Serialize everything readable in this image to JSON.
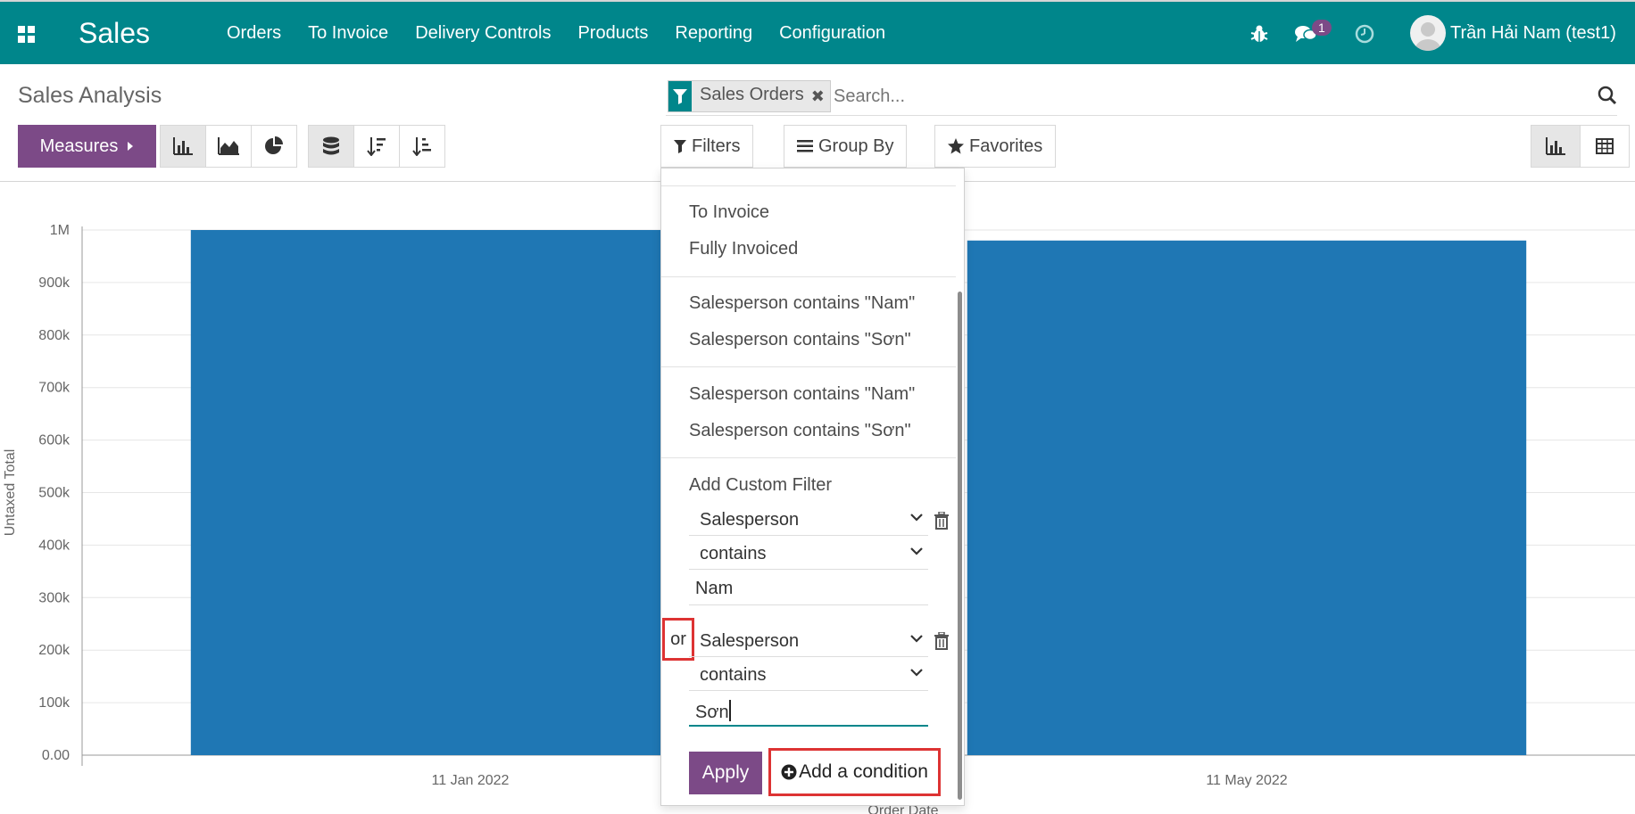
{
  "navbar": {
    "app_name": "Sales",
    "menu": [
      "Orders",
      "To Invoice",
      "Delivery Controls",
      "Products",
      "Reporting",
      "Configuration"
    ],
    "chat_count": "1",
    "user_name": "Trần Hải Nam (test1)"
  },
  "page": {
    "title": "Sales Analysis"
  },
  "search": {
    "facet_label": "Sales Orders",
    "placeholder": "Search..."
  },
  "toolbar": {
    "measures_label": "Measures",
    "filters_label": "Filters",
    "group_by_label": "Group By",
    "favorites_label": "Favorites"
  },
  "filters_menu": {
    "items_group1": [
      "To Invoice",
      "Fully Invoiced"
    ],
    "items_group2": [
      "Salesperson contains \"Nam\"",
      "Salesperson contains \"Sơn\""
    ],
    "items_group3": [
      "Salesperson contains \"Nam\"",
      "Salesperson contains \"Sơn\""
    ],
    "custom_filter_title": "Add Custom Filter",
    "condition1": {
      "field": "Salesperson",
      "operator": "contains",
      "value": "Nam"
    },
    "condition2": {
      "connector": "or",
      "field": "Salesperson",
      "operator": "contains",
      "value": "Sơn"
    },
    "apply_label": "Apply",
    "add_condition_label": "Add a condition"
  },
  "chart_data": {
    "type": "bar",
    "categories": [
      "11 Jan 2022",
      "11 May 2022"
    ],
    "values": [
      1000000,
      980000
    ],
    "title": "",
    "xlabel": "Order Date",
    "ylabel": "Untaxed Total",
    "ylim": [
      0,
      1000000
    ],
    "yticks": [
      "0.00",
      "100k",
      "200k",
      "300k",
      "400k",
      "500k",
      "600k",
      "700k",
      "800k",
      "900k",
      "1M"
    ],
    "bar_color": "#1f77b4",
    "grid": true
  },
  "colors": {
    "navbar": "#00868b",
    "primary": "#7c4a87",
    "highlight": "#dd3333"
  }
}
